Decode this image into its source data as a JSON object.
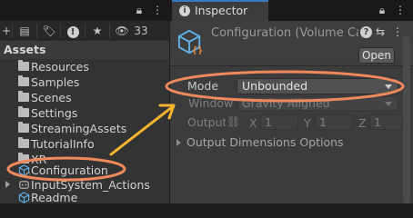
{
  "project": {
    "toolbar": {
      "hidden_count": "33"
    },
    "assets_title": "Assets",
    "items": [
      {
        "label": "Resources",
        "icon": "folder-icon"
      },
      {
        "label": "Samples",
        "icon": "folder-icon"
      },
      {
        "label": "Scenes",
        "icon": "folder-icon"
      },
      {
        "label": "Settings",
        "icon": "folder-icon"
      },
      {
        "label": "StreamingAssets",
        "icon": "folder-icon"
      },
      {
        "label": "TutorialInfo",
        "icon": "folder-icon"
      },
      {
        "label": "XR",
        "icon": "folder-icon"
      },
      {
        "label": "Configuration",
        "icon": "volume-camera-config-icon"
      },
      {
        "label": "InputSystem_Actions",
        "icon": "input-actions-icon"
      },
      {
        "label": "Readme",
        "icon": "readme-icon"
      }
    ]
  },
  "inspector": {
    "tab_label": "Inspector",
    "title": "Configuration (Volume Camera Window Configuration)",
    "open_label": "Open",
    "mode_label": "Mode",
    "mode_value": "Unbounded",
    "window_label": "Window",
    "window_value": "Gravity Aligned",
    "output_label": "Output",
    "dims": {
      "x_label": "X",
      "x_value": "1",
      "y_label": "Y",
      "y_value": "1",
      "z_label": "Z",
      "z_value": "1"
    },
    "output_dims_label": "Output Dimensions Options"
  },
  "colors": {
    "highlight": "#f08a5d",
    "arrow": "#f5b52e",
    "icon_blue": "#5fb3e8",
    "icon_orange": "#f08c3a",
    "tab_accent": "#3a79bb"
  }
}
